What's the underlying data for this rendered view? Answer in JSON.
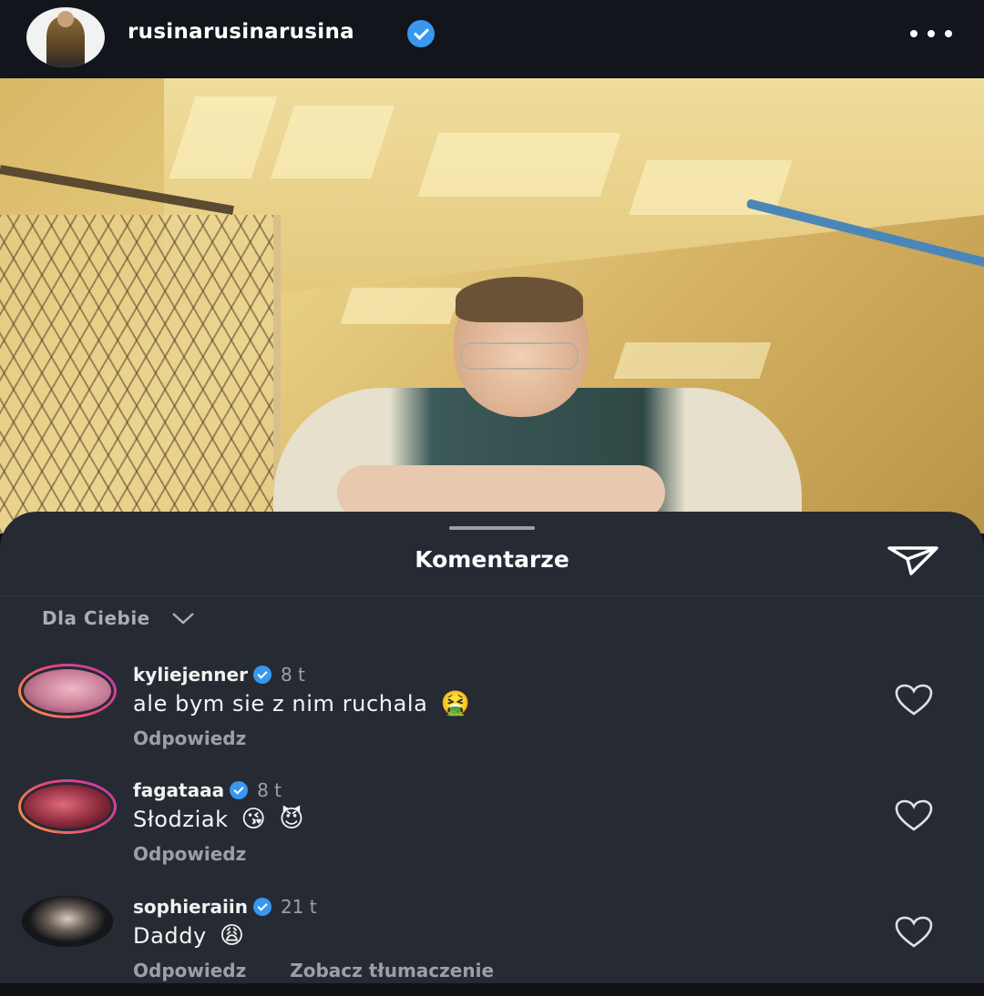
{
  "post": {
    "username": "rusinarusinarusina",
    "verified": true,
    "more_icon": "more-horizontal-icon"
  },
  "comments_sheet": {
    "title": "Komentarze",
    "share_icon": "send-icon",
    "sort_label": "Dla Ciebie",
    "comments": [
      {
        "username": "kyliejenner",
        "verified": true,
        "time": "8 t",
        "text": "ale bym sie z nim ruchala",
        "emojis": [
          "🤮"
        ],
        "reply_label": "Odpowiedz",
        "translate_label": ""
      },
      {
        "username": "fagataaa",
        "verified": true,
        "time": "8 t",
        "text": "Słodziak",
        "emojis": [
          "😘",
          "😈"
        ],
        "reply_label": "Odpowiedz",
        "translate_label": ""
      },
      {
        "username": "sophieraiin",
        "verified": true,
        "time": "21 t",
        "text": "Daddy",
        "emojis": [
          "😩"
        ],
        "reply_label": "Odpowiedz",
        "translate_label": "Zobacz tłumaczenie"
      }
    ]
  },
  "colors": {
    "background": "#101216",
    "sheet": "#262a33",
    "verified": "#3897f0",
    "muted_text": "#9aa0aa"
  }
}
